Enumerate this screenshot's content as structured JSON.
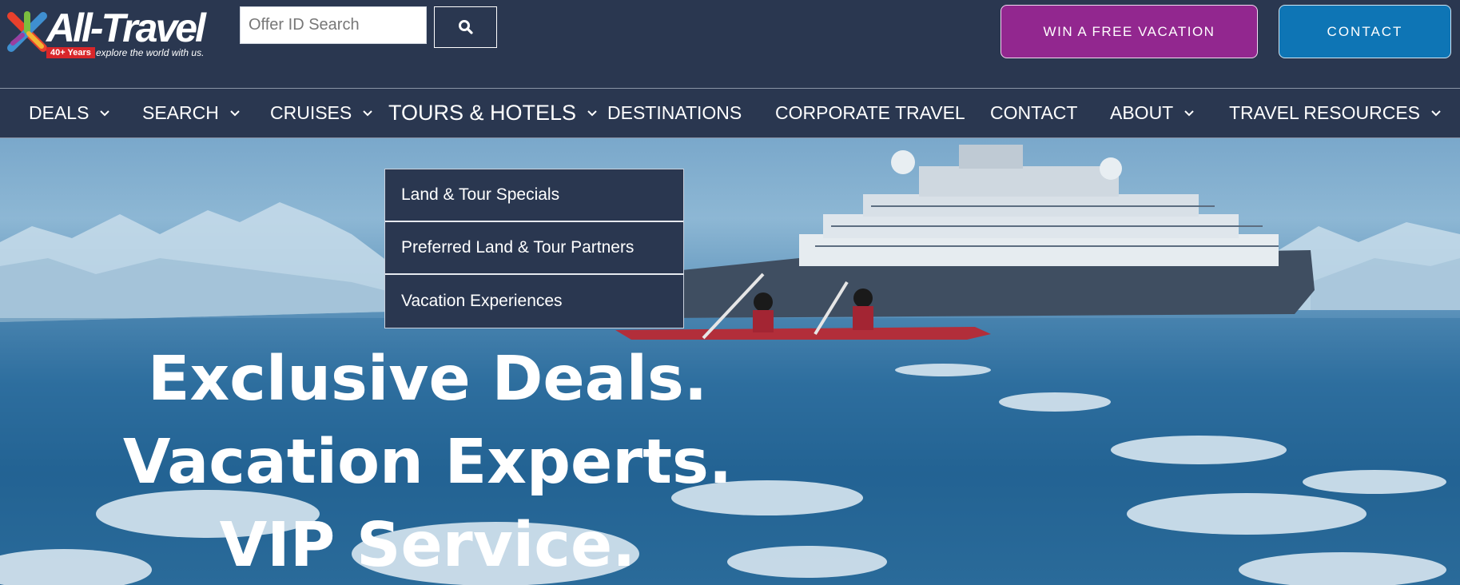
{
  "header": {
    "logo": {
      "name": "All-Travel",
      "badge": "40+ Years",
      "tagline": "explore the world with us."
    },
    "search": {
      "placeholder": "Offer ID Search",
      "value": ""
    },
    "win_button": "WIN A FREE VACATION",
    "contact_button": "CONTACT"
  },
  "nav": {
    "items": [
      {
        "label": "DEALS",
        "dropdown": true
      },
      {
        "label": "SEARCH",
        "dropdown": true
      },
      {
        "label": "CRUISES",
        "dropdown": true
      },
      {
        "label": "TOURS & HOTELS",
        "dropdown": true,
        "active": true
      },
      {
        "label": "DESTINATIONS",
        "dropdown": false
      },
      {
        "label": "CORPORATE TRAVEL",
        "dropdown": false
      },
      {
        "label": "CONTACT",
        "dropdown": false
      },
      {
        "label": "ABOUT",
        "dropdown": true
      },
      {
        "label": "TRAVEL RESOURCES",
        "dropdown": true
      }
    ]
  },
  "dropdown": {
    "items": [
      {
        "label": "Land & Tour Specials"
      },
      {
        "label": "Preferred Land & Tour Partners"
      },
      {
        "label": "Vacation Experiences"
      }
    ]
  },
  "hero": {
    "lines": [
      "Exclusive Deals.",
      "Vacation Experts.",
      "VIP Service."
    ]
  },
  "colors": {
    "header_bg": "#2a3750",
    "win_button": "#92278f",
    "contact_button": "#0e75b5"
  }
}
